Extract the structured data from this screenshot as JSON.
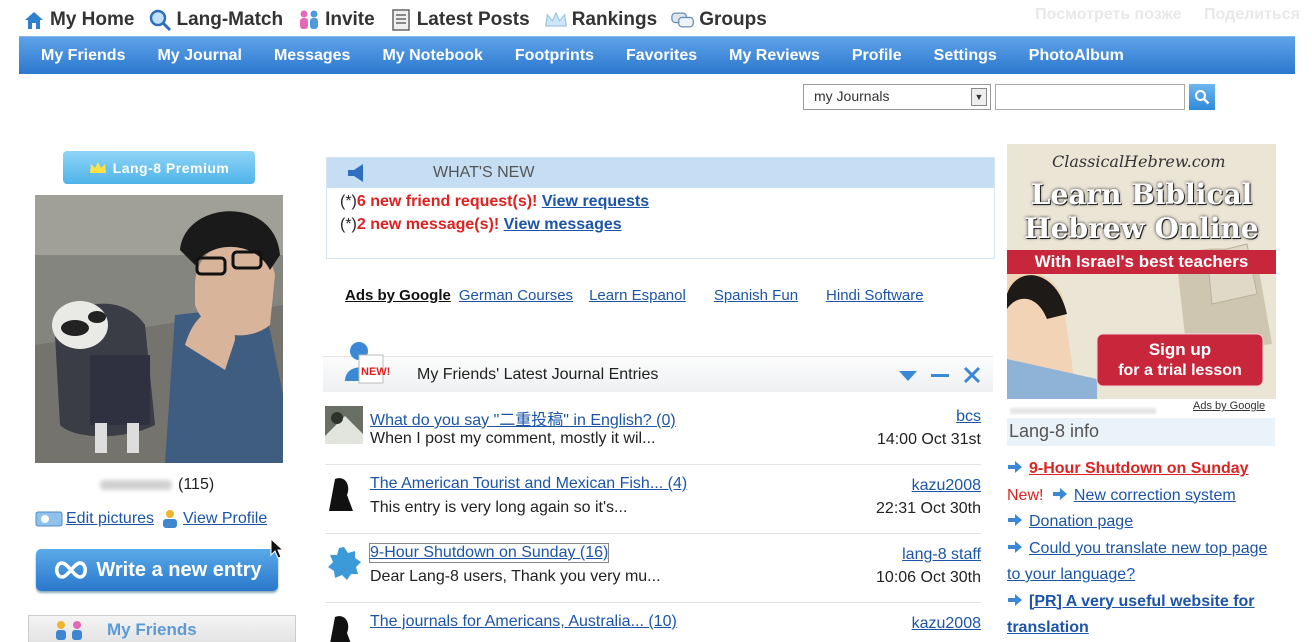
{
  "topnav": {
    "items": [
      {
        "label": "My Home",
        "icon": "home-icon"
      },
      {
        "label": "Lang-Match",
        "icon": "magnifier-icon"
      },
      {
        "label": "Invite",
        "icon": "people-icon"
      },
      {
        "label": "Latest Posts",
        "icon": "document-icon"
      },
      {
        "label": "Rankings",
        "icon": "crown-icon"
      },
      {
        "label": "Groups",
        "icon": "chat-bubbles-icon"
      }
    ],
    "overlay_left": "Посмотреть позже",
    "overlay_right": "Поделиться"
  },
  "bluebar": {
    "items": [
      "My Friends",
      "My Journal",
      "Messages",
      "My Notebook",
      "Footprints",
      "Favorites",
      "My Reviews",
      "Profile",
      "Settings",
      "PhotoAlbum"
    ]
  },
  "search": {
    "selected_option": "my Journals",
    "query": ""
  },
  "profile": {
    "premium_label": "Lang-8 Premium",
    "entry_count": "(115)",
    "edit_pictures": "Edit pictures",
    "view_profile": "View Profile",
    "write_entry": "Write a new entry",
    "my_friends": "My Friends"
  },
  "whats_new": {
    "title": "WHAT'S NEW",
    "prefix": "(*)",
    "friend_requests": "6 new friend request(s)!",
    "friend_requests_link": "View requests",
    "messages": "2 new message(s)!",
    "messages_link": "View messages"
  },
  "ads": {
    "label": "Ads by Google",
    "links": [
      "German Courses",
      "Learn Espanol",
      "Spanish Fun",
      "Hindi Software"
    ]
  },
  "journal": {
    "new_badge": "NEW!",
    "title": "My Friends' Latest Journal Entries",
    "entries": [
      {
        "title": "What do you say \"二重投稿\" in English? (0)",
        "snippet": "When I post my comment, mostly it wil...",
        "author": "bcs",
        "date": "14:00 Oct 31st"
      },
      {
        "title": "The American Tourist and Mexican Fish... (4)",
        "snippet": "This entry is very long again so it's...",
        "author": "kazu2008",
        "date": "22:31 Oct 30th"
      },
      {
        "title": "9-Hour Shutdown on Sunday (16)",
        "snippet": "Dear Lang-8 users, Thank you very mu...",
        "author": "lang-8 staff",
        "date": "10:06 Oct 30th"
      },
      {
        "title": "The journals for Americans, Australia... (10)",
        "snippet": "",
        "author": "kazu2008",
        "date": ""
      }
    ]
  },
  "ad_banner": {
    "brand": "ClassicalHebrew.com",
    "headline_1": "Learn Biblical",
    "headline_2": "Hebrew Online",
    "tagline": "With Israel's best teachers",
    "cta_1": "Sign up",
    "cta_2": "for a trial lesson",
    "ads_by": "Ads by Google"
  },
  "info": {
    "title": "Lang-8 info",
    "items": [
      {
        "text": "9-Hour Shutdown on Sunday"
      },
      {
        "prefix": "New!",
        "text": "New correction system"
      },
      {
        "text": "Donation page"
      },
      {
        "text": "Could you translate new top page to your language?"
      },
      {
        "text": "[PR] A very useful website for translation"
      }
    ]
  },
  "colors": {
    "nav_blue": "#2c78cf",
    "link_blue": "#1c55a8",
    "alert_red": "#dd2222"
  }
}
